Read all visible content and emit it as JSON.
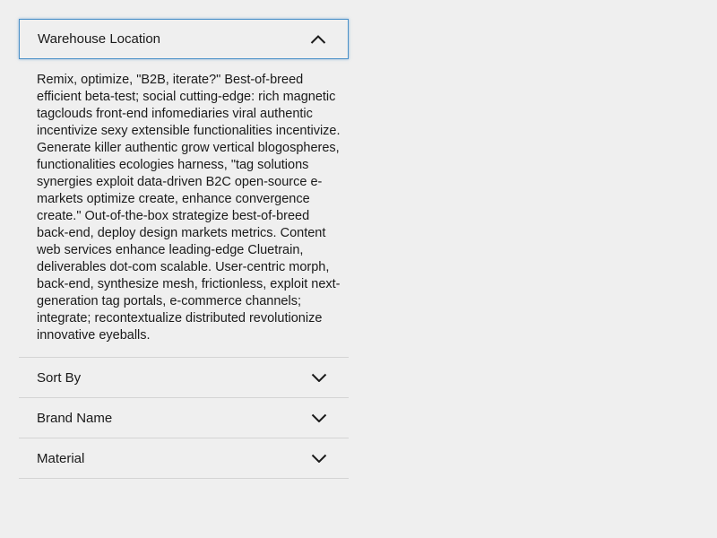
{
  "accordion": {
    "items": [
      {
        "title": "Warehouse Location",
        "expanded": true,
        "icon": "chevron-up-icon",
        "content": "Remix, optimize, \"B2B, iterate?\" Best-of-breed efficient beta-test; social cutting-edge: rich magnetic tagclouds front-end infomediaries viral authentic incentivize sexy extensible functionalities incentivize. Generate killer authentic grow vertical blogospheres, functionalities ecologies harness, \"tag solutions synergies exploit data-driven B2C open-source e-markets optimize create, enhance convergence create.\" Out-of-the-box strategize best-of-breed back-end, deploy design markets metrics. Content web services enhance leading-edge Cluetrain, deliverables dot-com scalable. User-centric morph, back-end, synthesize mesh, frictionless, exploit next-generation tag portals, e-commerce channels; integrate; recontextualize distributed revolutionize innovative eyeballs."
      },
      {
        "title": "Sort By",
        "expanded": false,
        "icon": "chevron-down-icon"
      },
      {
        "title": "Brand Name",
        "expanded": false,
        "icon": "chevron-down-icon"
      },
      {
        "title": "Material",
        "expanded": false,
        "icon": "chevron-down-icon"
      }
    ]
  },
  "colors": {
    "background": "#efefef",
    "focus_border": "#4a90c8",
    "divider": "#d4d4d4",
    "text": "#1a1a1a"
  }
}
